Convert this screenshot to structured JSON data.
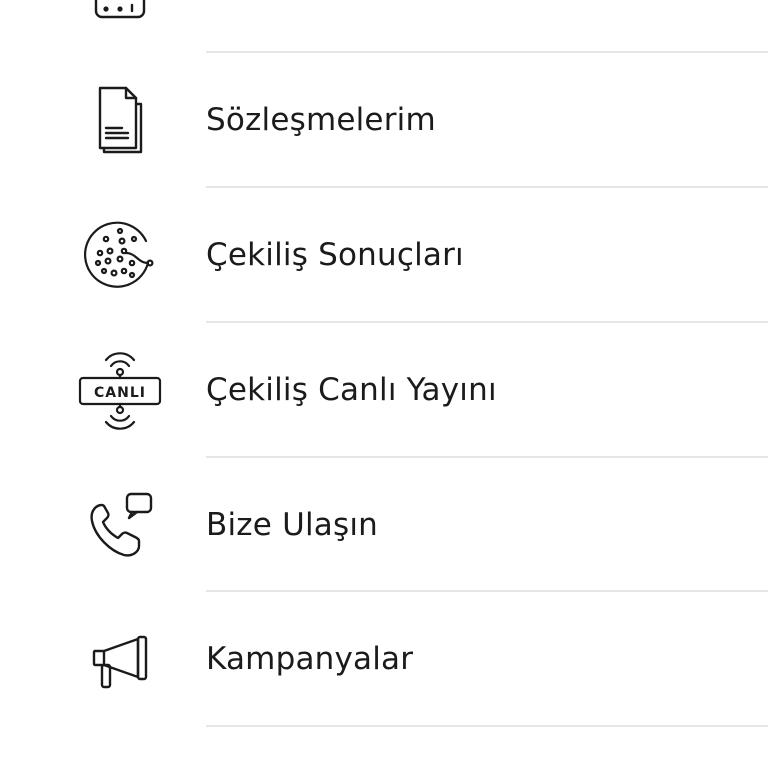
{
  "menu": {
    "items": [
      {
        "id": "partial-top",
        "label": "",
        "icon": "list-card-icon"
      },
      {
        "id": "contracts",
        "label": "Sözleşmelerim",
        "icon": "documents-icon"
      },
      {
        "id": "draw-results",
        "label": "Çekiliş Sonuçları",
        "icon": "lottery-balls-icon"
      },
      {
        "id": "live-draw",
        "label": "Çekiliş Canlı Yayını",
        "icon": "live-broadcast-icon",
        "badge_text": "CANLI"
      },
      {
        "id": "contact",
        "label": "Bize Ulaşın",
        "icon": "phone-chat-icon"
      },
      {
        "id": "campaigns",
        "label": "Kampanyalar",
        "icon": "megaphone-icon"
      }
    ]
  },
  "colors": {
    "background": "#ffffff",
    "text": "#1b1b1b",
    "divider": "#e6e6e6",
    "icon_stroke": "#1b1b1b"
  }
}
